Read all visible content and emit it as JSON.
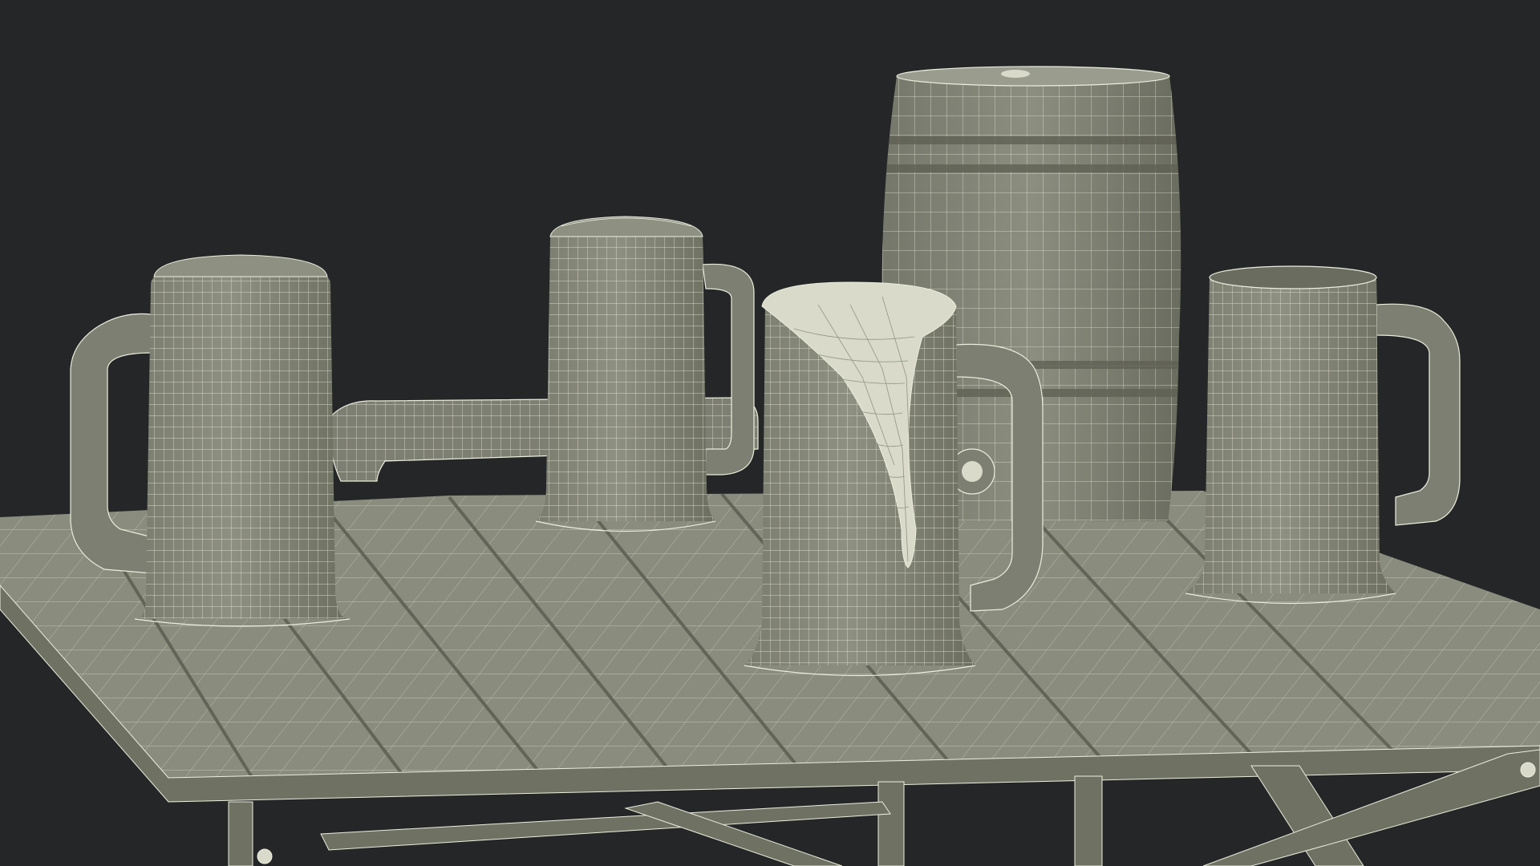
{
  "scene": {
    "objects": [
      {
        "kind": "mug",
        "state": "foam top"
      },
      {
        "kind": "mug",
        "state": "foam top"
      },
      {
        "kind": "mug",
        "state": "overflowing foam"
      },
      {
        "kind": "keg",
        "state": "with tap"
      },
      {
        "kind": "mug",
        "state": "empty"
      },
      {
        "kind": "table",
        "state": "slatted top with crossed legs"
      }
    ]
  },
  "colors": {
    "background": "#252627",
    "surface": "#8a8c7e",
    "surface_shade": "#6f7163",
    "wire": "#eceede",
    "foam": "#d9dac9"
  }
}
